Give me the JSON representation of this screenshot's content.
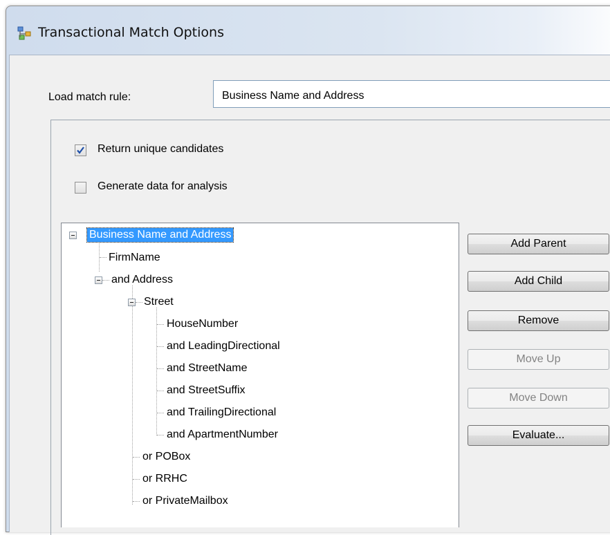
{
  "window": {
    "title": "Transactional Match Options",
    "icon": "tree-network-icon"
  },
  "match_rule": {
    "label": "Load match rule:",
    "value": "Business Name and Address"
  },
  "options": {
    "return_unique": {
      "label": "Return unique candidates",
      "checked": true
    },
    "generate_data": {
      "label": "Generate data for analysis",
      "checked": false
    }
  },
  "tree": {
    "nodes": [
      "Business Name and Address",
      "FirmName",
      "and Address",
      "Street",
      "HouseNumber",
      "and LeadingDirectional",
      "and StreetName",
      "and StreetSuffix",
      "and TrailingDirectional",
      "and ApartmentNumber",
      "or POBox",
      "or RRHC",
      "or PrivateMailbox"
    ]
  },
  "buttons": {
    "add_parent": "Add Parent",
    "add_child": "Add Child",
    "remove": "Remove",
    "move_up": "Move Up",
    "move_down": "Move Down",
    "evaluate": "Evaluate..."
  },
  "colors": {
    "selection": "#3399ff",
    "dialog_bg": "#f0f0f0",
    "titlebar": "#dbe5f1"
  }
}
